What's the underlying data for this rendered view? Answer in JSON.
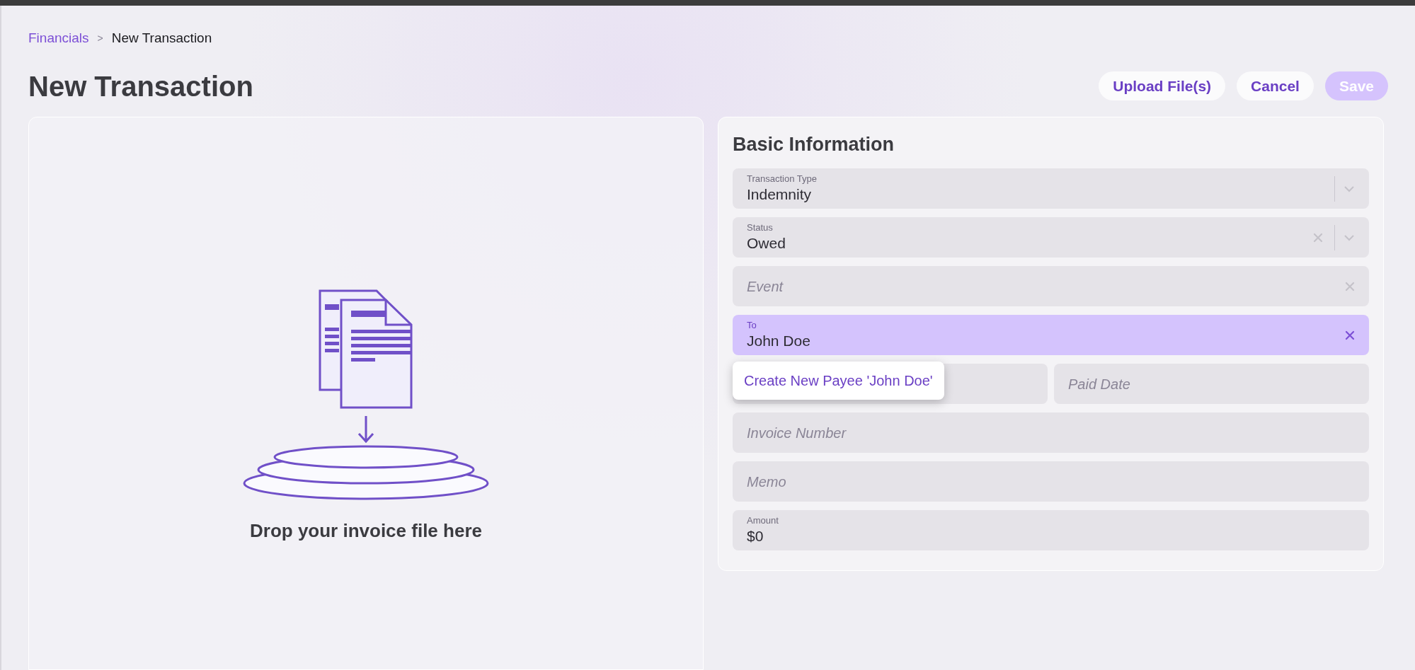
{
  "breadcrumb": [
    {
      "label": "Financials",
      "kind": "link"
    },
    {
      "label": "New Transaction",
      "kind": "current"
    }
  ],
  "breadcrumb_separator": ">",
  "title": "New Transaction",
  "actions": [
    {
      "label": "Upload File(s)",
      "disabled": false
    },
    {
      "label": "Cancel",
      "disabled": false
    },
    {
      "label": "Save",
      "disabled": true
    }
  ],
  "dropzone": {
    "text": "Drop your invoice file here"
  },
  "form": {
    "title": "Basic Information",
    "rows": [
      [
        {
          "kind": "select",
          "label": "Transaction Type",
          "value": "Indemnity",
          "clearable": false,
          "focused": false
        }
      ],
      [
        {
          "kind": "select",
          "label": "Status",
          "value": "Owed",
          "clearable": true,
          "focused": false
        }
      ],
      [
        {
          "kind": "text",
          "placeholder": "Event",
          "clearable": true,
          "focused": false
        }
      ],
      [
        {
          "kind": "text",
          "label": "To",
          "value": "John Doe",
          "clearable": true,
          "focused": true,
          "suggestion": "Create New Payee 'John Doe'"
        }
      ],
      [
        {
          "kind": "text",
          "clearable": false,
          "focused": false
        },
        {
          "kind": "text",
          "placeholder": "Paid Date",
          "clearable": false,
          "focused": false
        }
      ],
      [
        {
          "kind": "text",
          "placeholder": "Invoice Number",
          "clearable": false,
          "focused": false
        }
      ],
      [
        {
          "kind": "text",
          "placeholder": "Memo",
          "clearable": false,
          "focused": false
        }
      ],
      [
        {
          "kind": "text",
          "label": "Amount",
          "value": "$0",
          "clearable": false,
          "focused": false
        }
      ]
    ]
  }
}
